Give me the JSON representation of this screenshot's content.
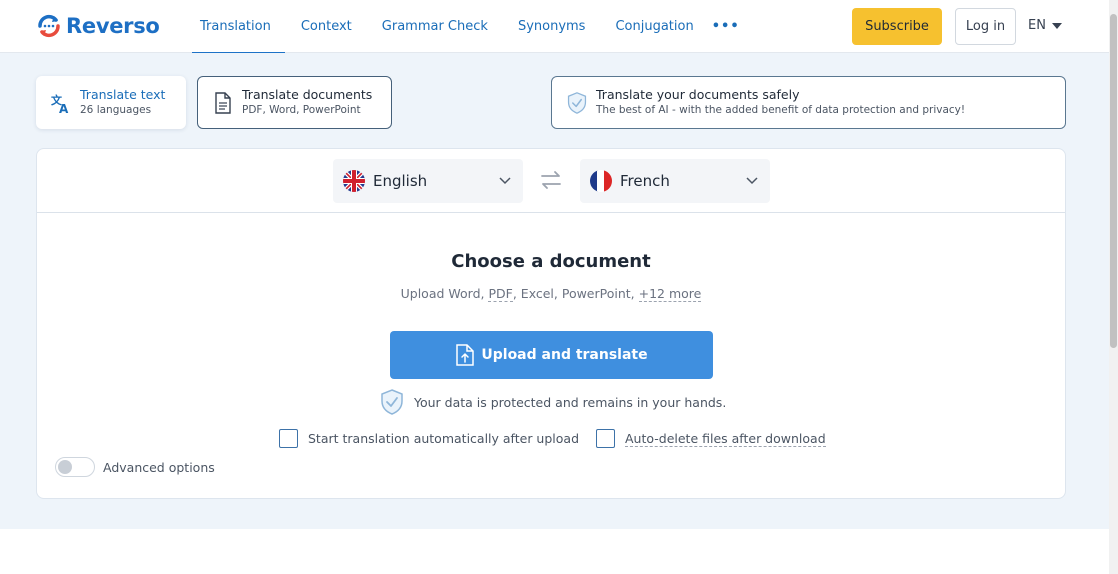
{
  "header": {
    "logo_text": "Reverso",
    "nav": [
      "Translation",
      "Context",
      "Grammar Check",
      "Synonyms",
      "Conjugation"
    ],
    "nav_more": "•••",
    "subscribe": "Subscribe",
    "login": "Log in",
    "ui_language": "EN"
  },
  "modes": {
    "text": {
      "title": "Translate text",
      "subtitle": "26 languages"
    },
    "documents": {
      "title": "Translate documents",
      "subtitle": "PDF, Word, PowerPoint"
    },
    "safe": {
      "title": "Translate your documents safely",
      "subtitle": "The best of AI - with the added benefit of data protection and privacy!"
    }
  },
  "languages": {
    "source": "English",
    "target": "French"
  },
  "upload": {
    "title": "Choose a document",
    "subtitle_prefix": "Upload Word, ",
    "subtitle_pdf": "PDF",
    "subtitle_mid": ", Excel, PowerPoint, ",
    "subtitle_more": "+12 more",
    "button": "Upload and translate",
    "protection": "Your data is protected and remains in your hands.",
    "option_auto": "Start translation automatically after upload",
    "option_delete": "Auto-delete files after download",
    "advanced": "Advanced options"
  },
  "colors": {
    "brand": "#1d6fc4",
    "accent": "#f6c12f",
    "button": "#3f8fdf"
  },
  "icons": [
    "reverso-logo-icon",
    "translate-icon",
    "document-icon",
    "shield-icon",
    "uk-flag-icon",
    "swap-icon",
    "france-flag-icon",
    "chevron-down-icon",
    "upload-file-icon"
  ]
}
